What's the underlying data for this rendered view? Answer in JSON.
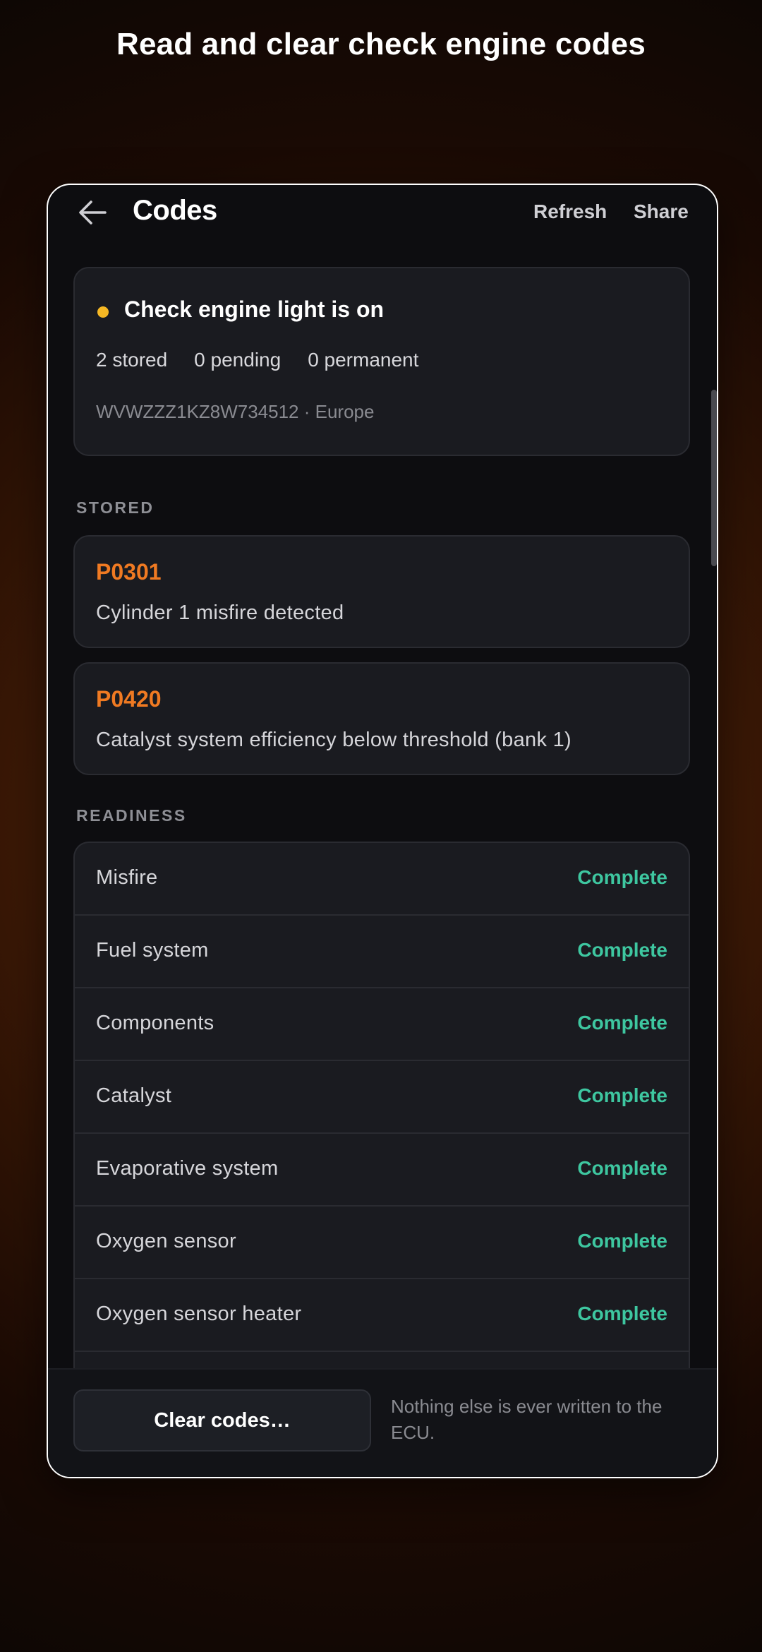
{
  "headline": "Read and clear check engine codes",
  "appbar": {
    "title": "Codes",
    "actions": {
      "refresh": "Refresh",
      "share": "Share"
    }
  },
  "summary": {
    "title": "Check engine light is on",
    "stored": "2 stored",
    "pending": "0 pending",
    "permanent": "0 permanent",
    "vehicle": "WVWZZZ1KZ8W734512 · Europe",
    "indicator_color": "#f6b824"
  },
  "stored_section": {
    "label": "STORED",
    "codes": [
      {
        "code": "P0301",
        "description": "Cylinder 1 misfire detected"
      },
      {
        "code": "P0420",
        "description": "Catalyst system efficiency below threshold (bank 1)"
      }
    ]
  },
  "readiness_section": {
    "label": "READINESS",
    "items": [
      {
        "name": "Misfire",
        "status": "Complete"
      },
      {
        "name": "Fuel system",
        "status": "Complete"
      },
      {
        "name": "Components",
        "status": "Complete"
      },
      {
        "name": "Catalyst",
        "status": "Complete"
      },
      {
        "name": "Evaporative system",
        "status": "Complete"
      },
      {
        "name": "Oxygen sensor",
        "status": "Complete"
      },
      {
        "name": "Oxygen sensor heater",
        "status": "Complete"
      }
    ]
  },
  "bottom": {
    "clear_label": "Clear codes…",
    "note": "Nothing else is ever written to the ECU."
  },
  "colors": {
    "code_accent": "#f07a22",
    "status_complete": "#3ec7a0",
    "background_glow": "#5a2a0c"
  },
  "icons": {
    "back": "arrow-left-icon"
  }
}
